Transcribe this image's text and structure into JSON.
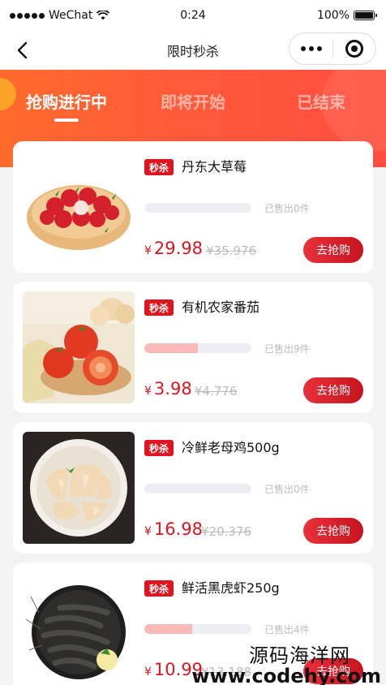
{
  "status_bar": {
    "carrier": "WeChat",
    "time": "0:24",
    "battery": "100%"
  },
  "nav": {
    "title": "限时秒杀"
  },
  "tabs": [
    {
      "label": "抢购进行中",
      "active": true
    },
    {
      "label": "即将开始",
      "active": false
    },
    {
      "label": "已结束",
      "active": false
    }
  ],
  "products": [
    {
      "badge": "秒杀",
      "name": "丹东大草莓",
      "sold": "已售出0件",
      "progress": 0,
      "price_symbol": "¥",
      "price": "29.98",
      "original_price": "¥35.976",
      "button": "去抢购",
      "image_icon": "strawberry-image"
    },
    {
      "badge": "秒杀",
      "name": "有机农家番茄",
      "sold": "已售出9件",
      "progress": 0.5,
      "price_symbol": "¥",
      "price": "3.98",
      "original_price": "¥4.776",
      "button": "去抢购",
      "image_icon": "tomato-image"
    },
    {
      "badge": "秒杀",
      "name": "冷鲜老母鸡500g",
      "sold": "已售出0件",
      "progress": 0,
      "price_symbol": "¥",
      "price": "16.98",
      "original_price": "¥20.376",
      "button": "去抢购",
      "image_icon": "chicken-image"
    },
    {
      "badge": "秒杀",
      "name": "鲜活黑虎虾250g",
      "sold": "已售出4件",
      "progress": 0.45,
      "price_symbol": "¥",
      "price": "10.99",
      "original_price": "¥13.188",
      "button": "去抢购",
      "image_icon": "shrimp-image"
    }
  ],
  "watermark": {
    "line1": "源码海洋网",
    "line2": "www.codehy.com"
  },
  "colors": {
    "accent": "#e0141e",
    "banner_start": "#ff6a2b",
    "banner_end": "#ff4e40",
    "progress_fill": "#f9b9b9",
    "progress_track": "#eceef3",
    "page_bg": "#f3f3f3"
  }
}
